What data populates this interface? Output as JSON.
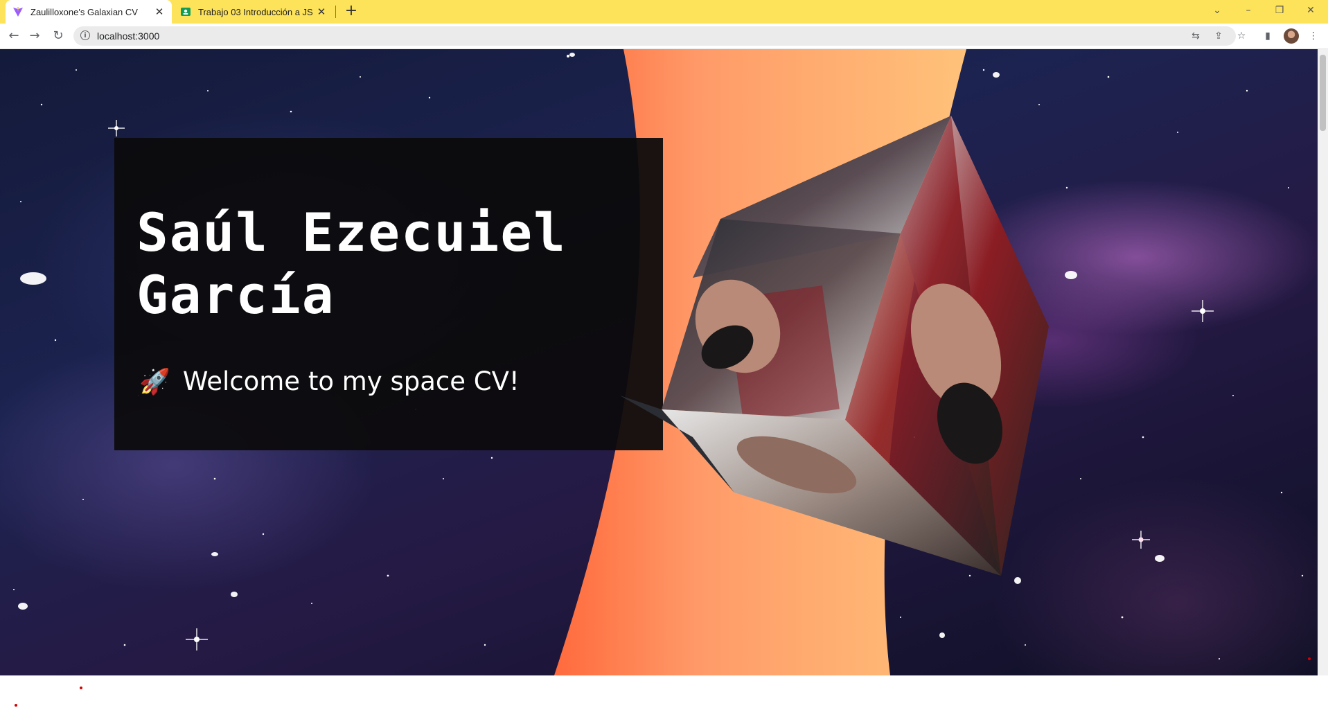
{
  "browser": {
    "tabs": [
      {
        "title": "Zaulilloxone's Galaxian CV",
        "active": true,
        "favicon": "vite-icon"
      },
      {
        "title": "Trabajo 03 Introducción a JS",
        "active": false,
        "favicon": "classroom-icon"
      }
    ],
    "address": "localhost:3000",
    "colors": {
      "tabbar": "#fde35a"
    }
  },
  "hero": {
    "name": "Saúl Ezecuiel García",
    "welcome_icon": "🚀",
    "welcome": "Welcome to my space CV!"
  },
  "colors": {
    "beam_start": "#ff6a3d",
    "beam_end": "#ffc27a",
    "card_bg": "#0c0b0c"
  },
  "icons": {
    "cube": "photo-cube-3d",
    "background": "galaxy-starfield"
  }
}
